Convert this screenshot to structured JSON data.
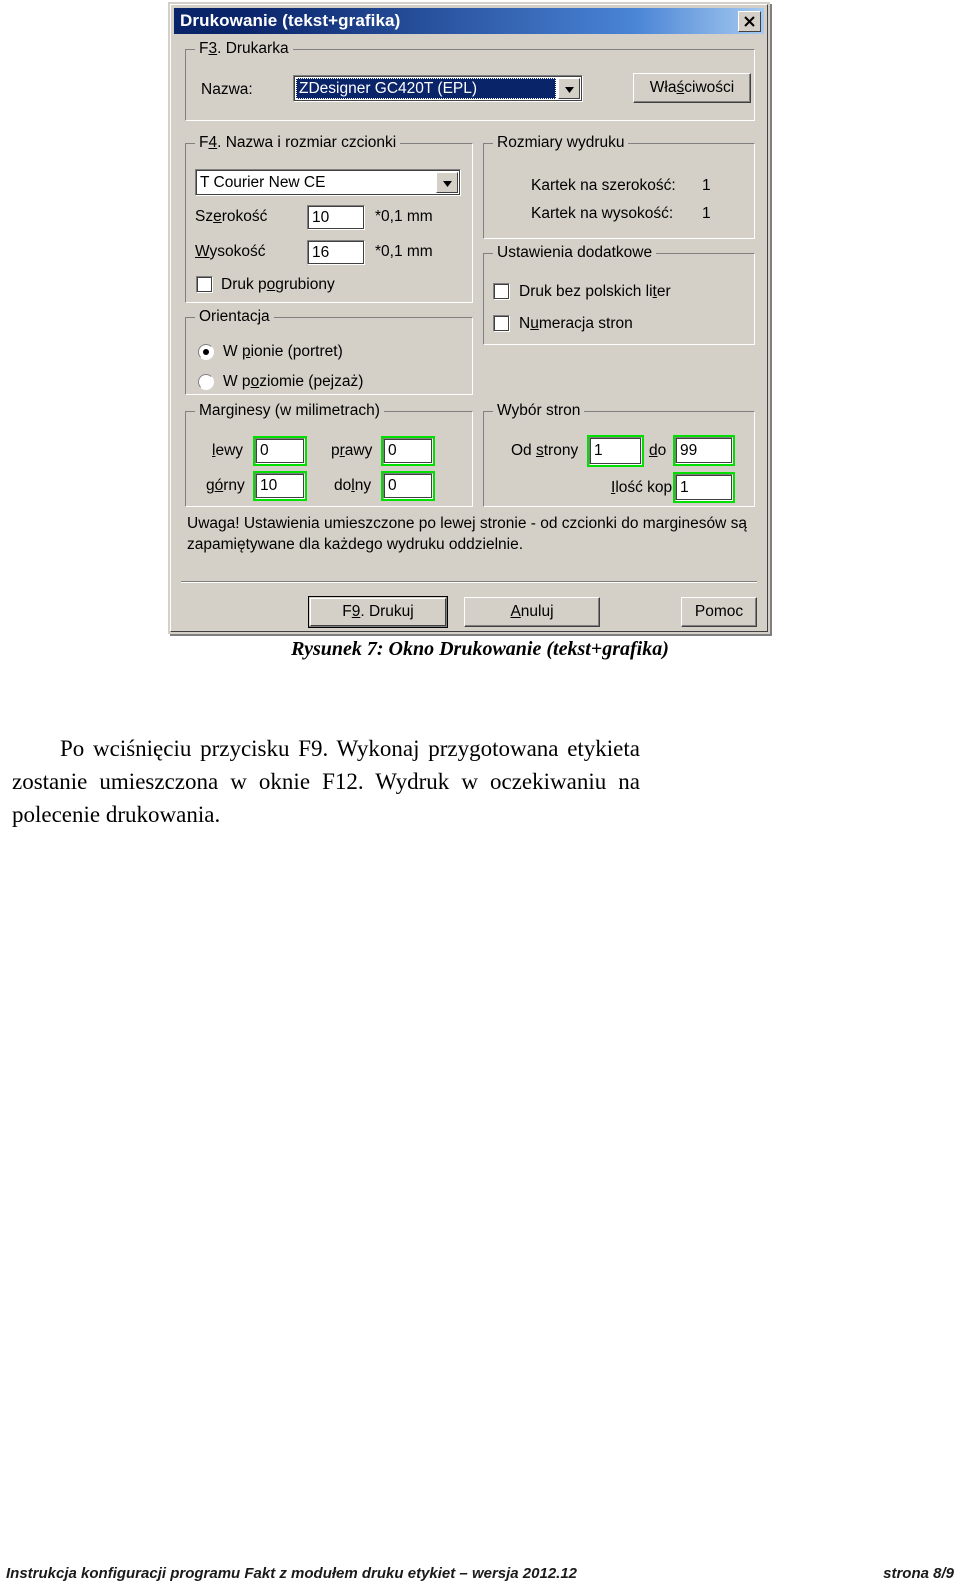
{
  "colors": {
    "dialog_face": "#d4d0c8",
    "titlebar_start": "#0a246a",
    "titlebar_end": "#a6caf0",
    "highlight_green": "#00e000",
    "selection_blue": "#0a246a"
  },
  "dialog": {
    "title": "Drukowanie (tekst+grafika)",
    "close_icon": "close-icon",
    "printer_group": {
      "legend_prefix": "F",
      "legend_accel": "3",
      "legend_rest": ". Drukarka",
      "legend_full": "F3. Drukarka",
      "name_label": "Nazwa:",
      "printer_value": "ZDesigner GC420T (EPL)",
      "dropdown_icon": "chevron-down-icon",
      "properties_button": {
        "before": "Wła",
        "accel": "ś",
        "after": "ciwości",
        "full": "Właściwości"
      }
    },
    "font_group": {
      "legend_prefix": "F",
      "legend_accel": "4",
      "legend_rest": ". Nazwa i rozmiar czcionki",
      "legend_full": "F4. Nazwa i rozmiar czcionki",
      "font_value": "T Courier New CE",
      "dropdown_icon": "chevron-down-icon",
      "width": {
        "before": "Sz",
        "accel": "e",
        "after": "rokość",
        "full": "Szerokość",
        "value": "10",
        "unit": "*0,1 mm"
      },
      "height": {
        "before": "",
        "accel": "W",
        "after": "ysokość",
        "full": "Wysokość",
        "value": "16",
        "unit": "*0,1 mm"
      },
      "bold_checkbox": {
        "before": "Druk p",
        "accel": "o",
        "after": "grubiony",
        "full": "Druk pogrubiony",
        "checked": false
      }
    },
    "orientation_group": {
      "legend_full": "Orientacja",
      "options": [
        {
          "before": "W ",
          "accel": "p",
          "after": "ionie (portret)",
          "full": "W pionie (portret)",
          "selected": true
        },
        {
          "before": "W p",
          "accel": "o",
          "after": "ziomie (pejzaż)",
          "full": "W poziomie (pejzaż)",
          "selected": false
        }
      ]
    },
    "margins_group": {
      "legend_full": "Marginesy (w milimetrach)",
      "fields": [
        {
          "before": "",
          "accel": "l",
          "after": "ewy",
          "full": "lewy",
          "value": "0"
        },
        {
          "before": "p",
          "accel": "r",
          "after": "awy",
          "full": "prawy",
          "value": "0"
        },
        {
          "before": "g",
          "accel": "ó",
          "after": "rny",
          "full": "górny",
          "value": "10"
        },
        {
          "before": "do",
          "accel": "l",
          "after": "ny",
          "full": "dolny",
          "value": "0"
        }
      ]
    },
    "sizes_group": {
      "legend_full": "Rozmiary wydruku",
      "rows": [
        {
          "label": "Kartek na szerokość:",
          "value": "1"
        },
        {
          "label": "Kartek na wysokość:",
          "value": "1"
        }
      ]
    },
    "extra_group": {
      "legend_full": "Ustawienia dodatkowe",
      "checkboxes": [
        {
          "before": "Druk bez polskich li",
          "accel": "t",
          "after": "er",
          "full": "Druk bez polskich liter",
          "checked": false
        },
        {
          "before": "N",
          "accel": "u",
          "after": "meracja stron",
          "full": "Numeracja stron",
          "checked": false
        }
      ]
    },
    "pages_group": {
      "legend_full": "Wybór stron",
      "from_label": {
        "before": "Od ",
        "accel": "s",
        "after": "trony",
        "full": "Od strony"
      },
      "from_value": "1",
      "to_label": {
        "before": "",
        "accel": "d",
        "after": "o",
        "full": "do"
      },
      "to_value": "99",
      "copies_label": {
        "before": "",
        "accel": "I",
        "after": "lość kopii",
        "full": "Ilość kopii"
      },
      "copies_value": "1"
    },
    "note": "Uwaga! Ustawienia umieszczone po lewej stronie - od czcionki do marginesów są zapamiętywane dla każdego wydruku oddzielnie.",
    "buttons": [
      {
        "before": "F",
        "accel": "9",
        "after": ". Drukuj",
        "full": "F9. Drukuj",
        "default": true
      },
      {
        "before": "",
        "accel": "A",
        "after": "nuluj",
        "full": "Anuluj",
        "default": false
      },
      {
        "before": "Pomoc",
        "accel": "",
        "after": "",
        "full": "Pomoc",
        "default": false
      }
    ]
  },
  "document": {
    "figure_caption": "Rysunek 7: Okno Drukowanie (tekst+grafika)",
    "paragraph": "Po wciśnięciu przycisku F9. Wykonaj przygotowana etykieta zostanie umieszczona w oknie F12. Wydruk w oczekiwaniu na polecenie drukowania.",
    "footer_left": "Instrukcja konfiguracji programu Fakt z modułem druku etykiet – wersja 2012.12",
    "footer_right": "strona 8/9"
  }
}
